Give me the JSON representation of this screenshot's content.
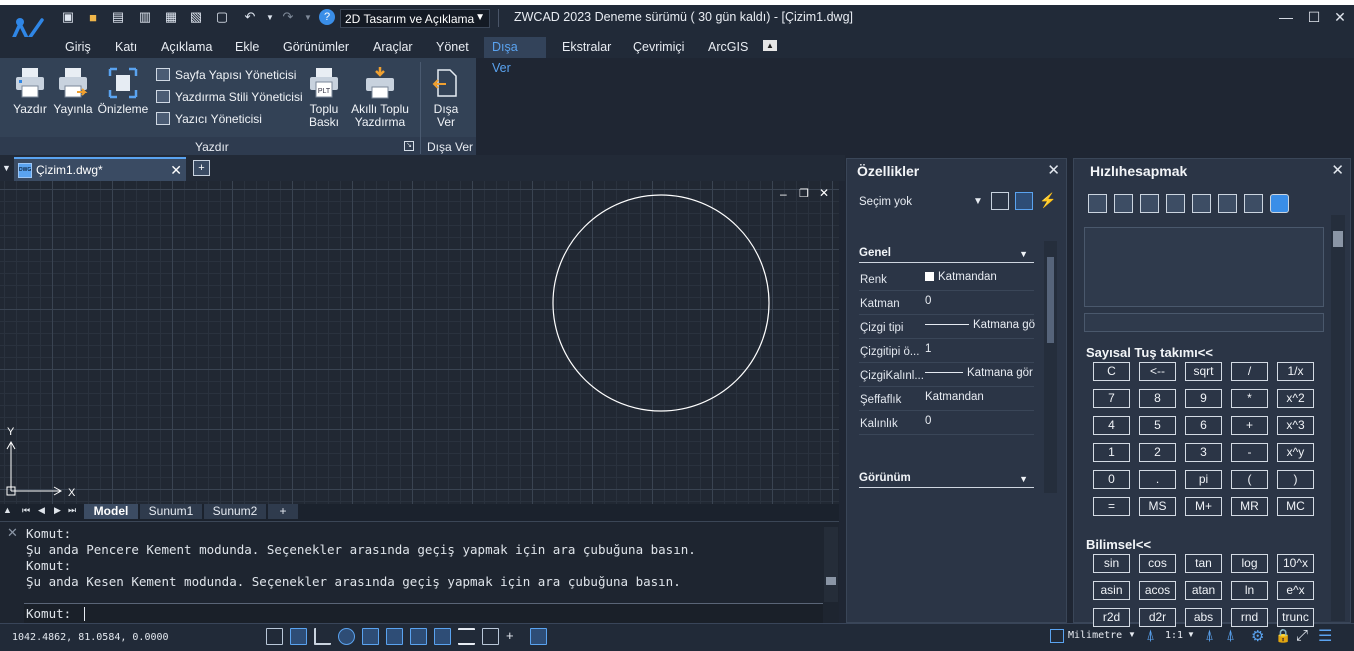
{
  "titlebar": {
    "workspace": "2D Tasarım ve Açıklama",
    "app_title": "ZWCAD 2023 Deneme sürümü ( 30 gün kaldı) - [Çizim1.dwg]"
  },
  "menu_tabs": [
    "Giriş",
    "Katı",
    "Açıklama",
    "Ekle",
    "Görünümler",
    "Araçlar",
    "Yönet",
    "Dışa Ver",
    "Ekstralar",
    "Çevrimiçi",
    "ArcGIS"
  ],
  "active_tab": "Dışa Ver",
  "ribbon": {
    "print": "Yazdır",
    "publish": "Yayınla",
    "preview": "Önizleme",
    "page_setup": "Sayfa Yapısı Yöneticisi",
    "plot_style": "Yazdırma Stili Yöneticisi",
    "plotter": "Yazıcı Yöneticisi",
    "batch_line1": "Toplu",
    "batch_line2": "Baskı",
    "smart_line1": "Akıllı Toplu",
    "smart_line2": "Yazdırma",
    "export_line1": "Dışa",
    "export_line2": "Ver",
    "group_print": "Yazdır",
    "group_export": "Dışa Ver",
    "batch_icon_text": "PLT"
  },
  "document": {
    "tab_name": "Çizim1.dwg*",
    "dwg_icon_text": "DWG"
  },
  "axes": {
    "y": "Y",
    "x": "X"
  },
  "layout_tabs": [
    "Model",
    "Sunum1",
    "Sunum2",
    "+"
  ],
  "command": {
    "lines": [
      "Komut:",
      "Şu anda Pencere Kement modunda. Seçenekler arasında geçiş yapmak için ara çubuğuna basın.",
      "Komut:",
      "Şu anda Kesen Kement modunda. Seçenekler arasında geçiş yapmak için ara çubuğuna basın."
    ],
    "prompt": "Komut:"
  },
  "status": {
    "coords": "1042.4862, 81.0584, 0.0000",
    "units": "Milimetre",
    "scale": "1:1"
  },
  "properties": {
    "title": "Özellikler",
    "selection": "Seçim yok",
    "section_general": "Genel",
    "rows": [
      {
        "key": "Renk",
        "value": "Katmandan"
      },
      {
        "key": "Katman",
        "value": "0"
      },
      {
        "key": "Çizgi tipi",
        "value": "Katmana gö"
      },
      {
        "key": "Çizgitipi ö...",
        "value": "1"
      },
      {
        "key": "ÇizgiKalınl...",
        "value": "Katmana gör"
      },
      {
        "key": "Şeffaflık",
        "value": "Katmandan"
      },
      {
        "key": "Kalınlık",
        "value": "0"
      }
    ],
    "section_view": "Görünüm"
  },
  "quickcalc": {
    "title": "Hızlıhesapmak",
    "numpad_title": "Sayısal Tuş takımı<<",
    "numpad": [
      [
        "C",
        "<--",
        "sqrt",
        "/",
        "1/x"
      ],
      [
        "7",
        "8",
        "9",
        "*",
        "x^2"
      ],
      [
        "4",
        "5",
        "6",
        "+",
        "x^3"
      ],
      [
        "1",
        "2",
        "3",
        "-",
        "x^y"
      ],
      [
        "0",
        ".",
        "pi",
        "(",
        ")"
      ],
      [
        "=",
        "MS",
        "M+",
        "MR",
        "MC"
      ]
    ],
    "sci_title": "Bilimsel<<",
    "scientific": [
      [
        "sin",
        "cos",
        "tan",
        "log",
        "10^x"
      ],
      [
        "asin",
        "acos",
        "atan",
        "ln",
        "e^x"
      ],
      [
        "r2d",
        "d2r",
        "abs",
        "rnd",
        "trunc"
      ]
    ]
  },
  "colors": {
    "accent": "#5aa3f0",
    "background": "#1f2633",
    "canvas": "#212833"
  }
}
